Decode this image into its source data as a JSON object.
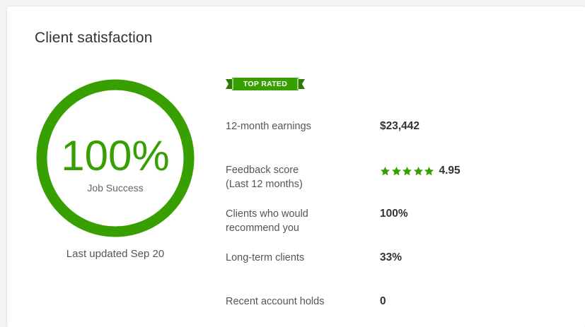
{
  "card": {
    "title": "Client satisfaction"
  },
  "job_success": {
    "percent_label": "100%",
    "label": "Job Success",
    "progress": 1.0,
    "updated": "Last updated Sep 20"
  },
  "badge": {
    "text": "TOP RATED"
  },
  "stats": {
    "earnings_label": "12-month earnings",
    "earnings_value": "$23,442",
    "feedback_label_1": "Feedback score",
    "feedback_label_2": "(Last 12 months)",
    "feedback_stars": 5,
    "feedback_value": "4.95",
    "recommend_label_1": "Clients who would",
    "recommend_label_2": "recommend you",
    "recommend_value": "100%",
    "longterm_label": "Long-term clients",
    "longterm_value": "33%",
    "holds_label": "Recent account holds",
    "holds_value": "0"
  },
  "colors": {
    "accent": "#37a000",
    "badge_dark": "#2a7d00"
  }
}
